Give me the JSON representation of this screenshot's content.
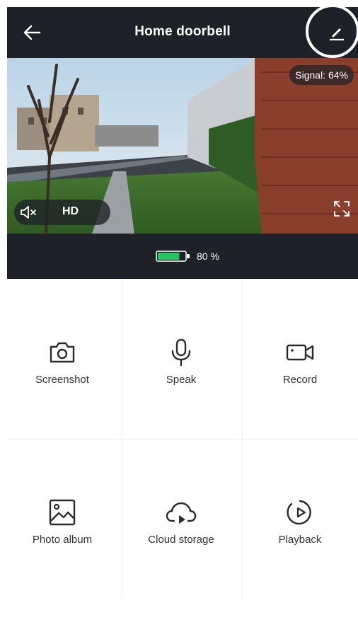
{
  "header": {
    "title": "Home doorbell"
  },
  "video": {
    "signal_text": "Signal: 64%",
    "quality_label": "HD"
  },
  "battery": {
    "level_percent": 80,
    "text": "80 %",
    "color": "#22c55e"
  },
  "actions": {
    "screenshot": "Screenshot",
    "speak": "Speak",
    "record": "Record",
    "photo_album": "Photo album",
    "cloud_storage": "Cloud storage",
    "playback": "Playback"
  },
  "colors": {
    "bar_bg": "#1e2127",
    "icon_stroke": "#2b2b2b"
  },
  "icons": [
    "back-arrow",
    "edit-pencil",
    "speaker-muted",
    "fullscreen",
    "camera",
    "microphone",
    "video-camera",
    "image",
    "cloud-play",
    "play-history"
  ]
}
